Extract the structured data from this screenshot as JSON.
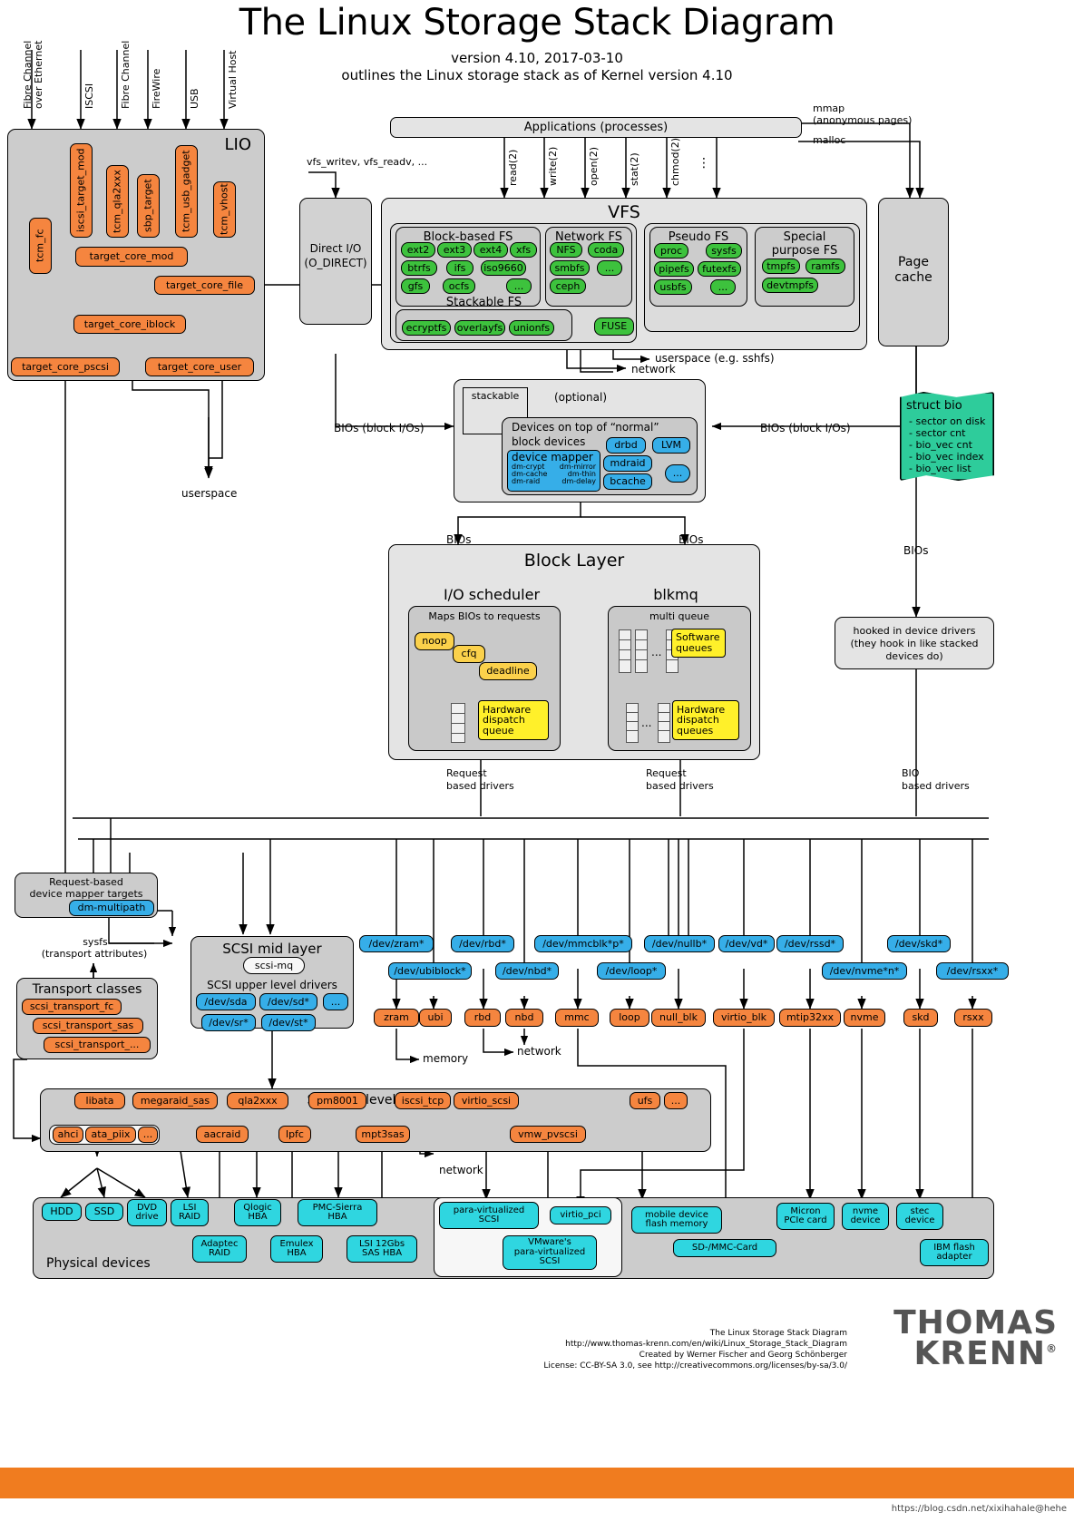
{
  "header": {
    "title": "The Linux Storage Stack Diagram",
    "subtitle1": "version 4.10, 2017-03-10",
    "subtitle2": "outlines the Linux storage stack as of Kernel version 4.10"
  },
  "transports": [
    "Fibre Channel\nover Ethernet",
    "ISCSI",
    "Fibre Channel",
    "FireWire",
    "USB",
    "Virtual Host"
  ],
  "lio": {
    "title": "LIO",
    "fabrics": [
      "tcm_fc",
      "iscsi_target_mod",
      "tcm_qla2xxx",
      "sbp_target",
      "tcm_usb_gadget",
      "tcm_vhost"
    ],
    "core": "target_core_mod",
    "backstores": [
      "target_core_file",
      "target_core_iblock",
      "target_core_pscsi",
      "target_core_user"
    ],
    "userspace_label": "userspace"
  },
  "applications": {
    "label": "Applications (processes)"
  },
  "syscalls": [
    "read(2)",
    "write(2)",
    "open(2)",
    "stat(2)",
    "chmod(2)",
    "⋮"
  ],
  "mmap": {
    "line1": "mmap",
    "line2": "(anonymous pages)",
    "line3": "malloc"
  },
  "vfs_entry_label": "vfs_writev, vfs_readv, ...",
  "direct_io": {
    "line1": "Direct I/O",
    "line2": "(O_DIRECT)"
  },
  "vfs": {
    "title": "VFS",
    "block_fs": {
      "title": "Block-based FS",
      "items": [
        "ext2",
        "ext3",
        "ext4",
        "xfs",
        "btrfs",
        "ifs",
        "iso9660",
        "gfs",
        "ocfs",
        "..."
      ]
    },
    "network_fs": {
      "title": "Network FS",
      "items": [
        "NFS",
        "coda",
        "smbfs",
        "...",
        "ceph"
      ]
    },
    "pseudo_fs": {
      "title": "Pseudo FS",
      "items": [
        "proc",
        "sysfs",
        "pipefs",
        "futexfs",
        "usbfs",
        "..."
      ]
    },
    "special_fs": {
      "title": "Special\npurpose FS",
      "items": [
        "tmpfs",
        "ramfs",
        "devtmpfs"
      ]
    },
    "stackable_fs": {
      "title": "Stackable FS",
      "items": [
        "ecryptfs",
        "overlayfs",
        "unionfs"
      ]
    },
    "fuse": "FUSE",
    "fuse_userspace": "userspace (e.g. sshfs)",
    "fuse_network": "network"
  },
  "page_cache": {
    "line1": "Page",
    "line2": "cache"
  },
  "struct_bio": {
    "title": "struct bio",
    "fields": [
      "- sector on disk",
      "- sector cnt",
      "- bio_vec cnt",
      "- bio_vec index",
      "- bio_vec list"
    ]
  },
  "optional_layer": {
    "stackable": "stackable",
    "optional": "(optional)",
    "devices_title_l1": "Devices on top of “normal”",
    "devices_title_l2": "block devices",
    "device_mapper": {
      "title": "device mapper",
      "targets": [
        "dm-crypt",
        "dm-mirror",
        "dm-cache",
        "dm-thin",
        "dm-raid",
        "dm-delay"
      ]
    },
    "others": [
      "drbd",
      "LVM",
      "mdraid",
      "bcache",
      "..."
    ]
  },
  "bios_labels": {
    "left": "BIOs (block I/Os)",
    "right": "BIOs (block I/Os)",
    "short": "BIOs"
  },
  "block_layer": {
    "title": "Block Layer",
    "io_scheduler": {
      "title": "I/O scheduler",
      "maps_label": "Maps BIOs to requests",
      "schedulers": [
        "noop",
        "cfq",
        "deadline"
      ],
      "hw_dispatch": "Hardware\ndispatch\nqueue"
    },
    "blkmq": {
      "title": "blkmq",
      "multi_queue": "multi queue",
      "software_queues": "Software\nqueues",
      "hw_dispatch": "Hardware\ndispatch\nqueues"
    }
  },
  "hooked_drivers": {
    "line1": "hooked in device drivers",
    "line2": "(they hook in like stacked",
    "line3": "devices do)"
  },
  "driver_labels": {
    "request_left_l1": "Request",
    "request_left_l2": "based drivers",
    "request_right_l1": "Request",
    "request_right_l2": "based drivers",
    "bio_l1": "BIO",
    "bio_l2": "based drivers"
  },
  "request_dm": {
    "line1": "Request-based",
    "line2": "device mapper targets",
    "target": "dm-multipath"
  },
  "sysfs_note": {
    "line1": "sysfs",
    "line2": "(transport attributes)"
  },
  "transport_classes": {
    "title": "Transport classes",
    "items": [
      "scsi_transport_fc",
      "scsi_transport_sas",
      "scsi_transport_..."
    ]
  },
  "scsi_mid": {
    "title": "SCSI mid layer",
    "scsi_mq": "scsi-mq",
    "upper_label": "SCSI upper level drivers",
    "devices": [
      "/dev/sda",
      "/dev/sd*",
      "...",
      "/dev/sr*",
      "/dev/st*"
    ]
  },
  "dev_nodes_top": [
    "/dev/zram*",
    "/dev/rbd*",
    "/dev/mmcblk*p*",
    "/dev/nullb*",
    "/dev/vd*",
    "/dev/rssd*",
    "/dev/skd*"
  ],
  "dev_nodes_bottom": [
    "/dev/ubiblock*",
    "/dev/nbd*",
    "/dev/loop*",
    "/dev/nvme*n*",
    "/dev/rsxx*"
  ],
  "block_drivers": [
    "zram",
    "ubi",
    "rbd",
    "nbd",
    "mmc",
    "loop",
    "null_blk",
    "virtio_blk",
    "mtip32xx",
    "nvme",
    "skd",
    "rsxx"
  ],
  "misc_labels": {
    "memory": "memory",
    "network1": "network",
    "network2": "network"
  },
  "scsi_low": {
    "title": "SCSI low level drivers",
    "row1": [
      "libata",
      "megaraid_sas",
      "qla2xxx",
      "pm8001",
      "iscsi_tcp",
      "virtio_scsi",
      "ufs",
      "..."
    ],
    "row2": [
      "aacraid",
      "lpfc",
      "mpt3sas",
      "vmw_pvscsi"
    ],
    "libata_group": [
      "ahci",
      "ata_piix",
      "..."
    ]
  },
  "physical": {
    "title": "Physical devices",
    "row1": [
      "HDD",
      "SSD",
      "DVD\ndrive",
      "LSI\nRAID",
      "Qlogic\nHBA",
      "PMC-Sierra\nHBA"
    ],
    "row2": [
      "Adaptec\nRAID",
      "Emulex\nHBA",
      "LSI 12Gbs\nSAS HBA"
    ],
    "virt": {
      "para": "para-virtualized\nSCSI",
      "virtio_pci": "virtio_pci",
      "vmware": "VMware's\npara-virtualized\nSCSI"
    },
    "flash": {
      "mobile": "mobile device\nflash memory",
      "sdmmc": "SD-/MMC-Card"
    },
    "right": [
      "Micron\nPCIe card",
      "nvme\ndevice",
      "stec\ndevice",
      "IBM flash\nadapter"
    ]
  },
  "footer": {
    "logo_line1": "THOMAS",
    "logo_line2": "KRENN",
    "l1": "The Linux Storage Stack Diagram",
    "l2": "http://www.thomas-krenn.com/en/wiki/Linux_Storage_Stack_Diagram",
    "l3": "Created by Werner Fischer and Georg Schönberger",
    "l4": "License: CC-BY-SA 3.0, see http://creativecommons.org/licenses/by-sa/3.0/",
    "watermark": "https://blog.csdn.net/xixihahale@hehe"
  },
  "colors": {
    "orange": "#f5853f",
    "green": "#3dc23d",
    "blue": "#36aee8",
    "yellow": "#fff02a",
    "amber": "#fbd14b",
    "cyan": "#2fd6e0",
    "teal": "#2ecc9b",
    "gray_group": "#cccccc",
    "brand": "#f07c1f"
  }
}
